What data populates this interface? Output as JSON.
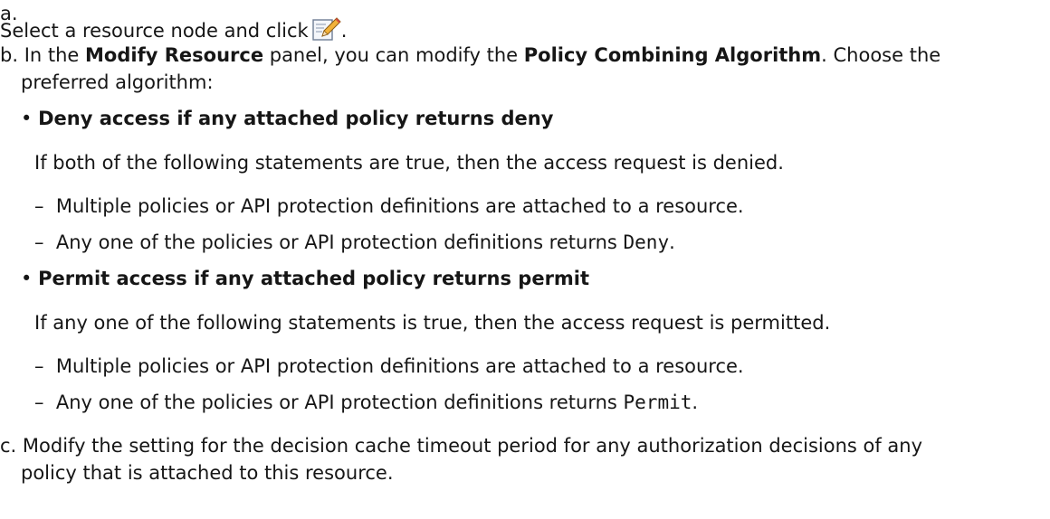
{
  "steps": {
    "a": {
      "marker": "a.",
      "text_before": "Select a resource node and click",
      "icon": "edit-icon",
      "text_after": "."
    },
    "b": {
      "marker": "b.",
      "t1": "In the ",
      "panel": "Modify Resource",
      "t2": " panel, you can modify the ",
      "field": "Policy Combining Algorithm",
      "t3": ". Choose the",
      "t4": "preferred algorithm:",
      "options": [
        {
          "bullet": "•",
          "title": "Deny access if any attached policy returns deny",
          "desc": "If both of the following statements are true, then the access request is denied.",
          "items": [
            {
              "dash": "–",
              "text": "Multiple policies or API protection definitions are attached to a resource."
            },
            {
              "dash": "–",
              "text_before": "Any one of the policies or API protection definitions returns ",
              "code": "Deny",
              "text_after": "."
            }
          ]
        },
        {
          "bullet": "•",
          "title": "Permit access if any attached policy returns permit",
          "desc": "If any one of the following statements is true, then the access request is permitted.",
          "items": [
            {
              "dash": "–",
              "text": "Multiple policies or API protection definitions are attached to a resource."
            },
            {
              "dash": "–",
              "text_before": "Any one of the policies or API protection definitions returns ",
              "code": "Permit",
              "text_after": "."
            }
          ]
        }
      ]
    },
    "c": {
      "marker": "c.",
      "line1": "Modify the setting for the decision cache timeout period for any authorization decisions of any",
      "line2": "policy that is attached to this resource."
    }
  }
}
